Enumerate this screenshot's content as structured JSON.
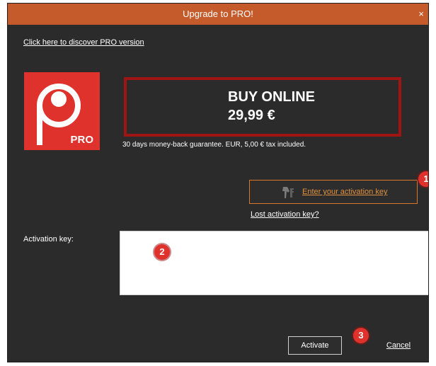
{
  "window": {
    "title": "Upgrade to PRO!",
    "close_glyph": "×"
  },
  "discover_link": "Click here to discover PRO version",
  "logo": {
    "text": "PRO",
    "color": "#e0322c"
  },
  "buy": {
    "title": "BUY ONLINE",
    "price": "29,99 €",
    "border_color": "#a01414"
  },
  "guarantee": "30 days money-back guarantee. EUR, 5,00 € tax included.",
  "activation_button": {
    "label": "Enter your activation key",
    "icon": "key-icon",
    "accent_color": "#e0913f"
  },
  "lost_key_link": "Lost activation key?",
  "activation_field": {
    "label": "Activation key:",
    "value": ""
  },
  "actions": {
    "activate": "Activate",
    "cancel": "Cancel"
  },
  "step_badges": [
    "1",
    "2",
    "3"
  ],
  "colors": {
    "titlebar": "#c55a2a",
    "background": "#2b2b2b",
    "badge": "#e0322c"
  }
}
